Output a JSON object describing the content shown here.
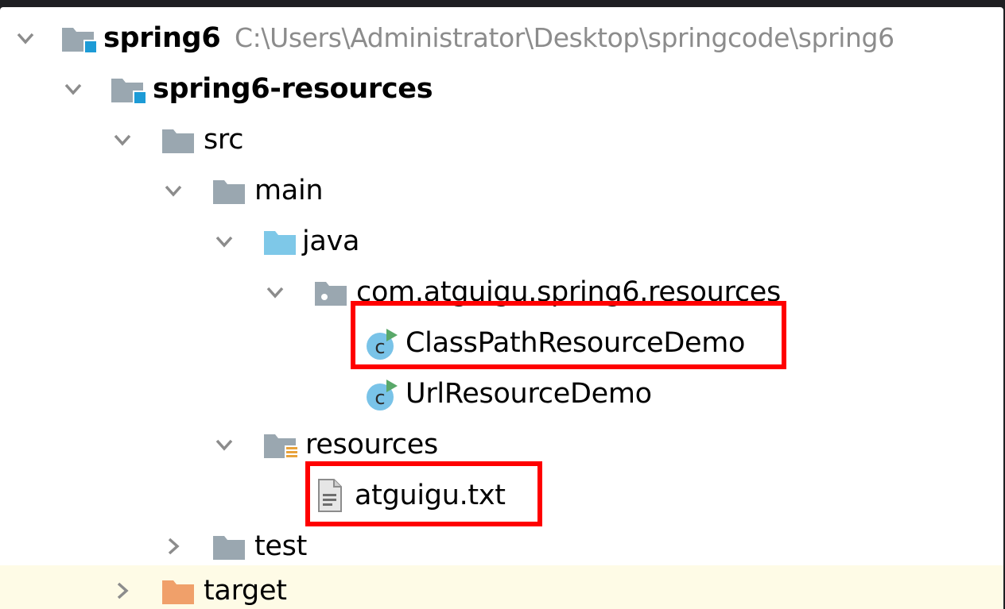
{
  "tree": {
    "nodes": [
      {
        "id": "spring6",
        "label": "spring6",
        "path": "C:\\Users\\Administrator\\Desktop\\springcode\\spring6",
        "expanded": true,
        "icon": "module-folder-icon"
      },
      {
        "id": "spring6-resources",
        "label": "spring6-resources",
        "expanded": true,
        "icon": "module-folder-icon"
      },
      {
        "id": "src",
        "label": "src",
        "expanded": true,
        "icon": "folder-icon"
      },
      {
        "id": "main",
        "label": "main",
        "expanded": true,
        "icon": "folder-icon"
      },
      {
        "id": "java",
        "label": "java",
        "expanded": true,
        "icon": "source-root-folder-icon"
      },
      {
        "id": "package",
        "label": "com.atguigu.spring6.resources",
        "expanded": true,
        "icon": "package-icon"
      },
      {
        "id": "classpath-demo",
        "label": "ClassPathResourceDemo",
        "icon": "java-class-runnable-icon",
        "annotated": true
      },
      {
        "id": "url-demo",
        "label": "UrlResourceDemo",
        "icon": "java-class-runnable-icon"
      },
      {
        "id": "resources",
        "label": "resources",
        "expanded": true,
        "icon": "resources-root-folder-icon"
      },
      {
        "id": "atguigu-txt",
        "label": "atguigu.txt",
        "icon": "text-file-icon",
        "annotated": true
      },
      {
        "id": "test",
        "label": "test",
        "expanded": false,
        "icon": "folder-icon"
      },
      {
        "id": "target",
        "label": "target",
        "expanded": false,
        "icon": "excluded-folder-icon",
        "highlighted": true
      }
    ]
  },
  "colors": {
    "background": "#1e1f22",
    "panel": "#ffffff",
    "folder": "#9aa7b0",
    "source_root": "#7ec8e8",
    "module_badge": "#1d9bd6",
    "excluded_folder": "#f0a06a",
    "class_circle": "#79c3e8",
    "run_triangle": "#59a869",
    "resources_lines": "#e8a33c",
    "annotation_red": "#ff0000",
    "highlight_row": "#fefbe6"
  }
}
